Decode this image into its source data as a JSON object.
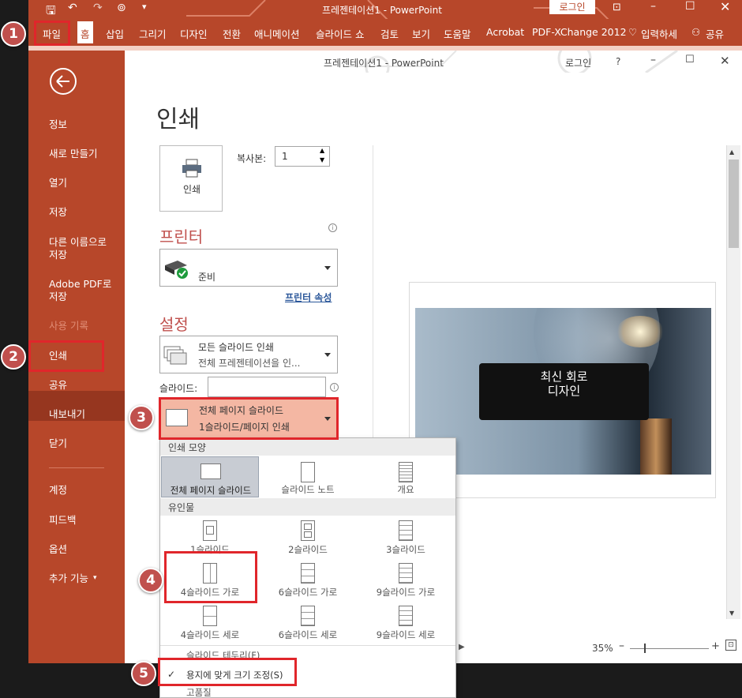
{
  "outer_window": {
    "title": "프레젠테이션1  -  PowerPoint",
    "login": "로그인",
    "tabs": [
      "파일",
      "홈",
      "삽입",
      "그리기",
      "디자인",
      "전환",
      "애니메이션",
      "슬라이드 쇼",
      "검토",
      "보기",
      "도움말",
      "Acrobat",
      "PDF-XChange 2012",
      "입력하세",
      "공유"
    ]
  },
  "inner_window": {
    "title": "프레젠테이션1  -  PowerPoint",
    "login": "로그인",
    "help": "?"
  },
  "sidebar": {
    "items": [
      "정보",
      "새로 만들기",
      "열기",
      "저장",
      "다른 이름으로 저장",
      "Adobe PDF로 저장",
      "사용 기록",
      "인쇄",
      "공유",
      "내보내기",
      "닫기",
      "계정",
      "피드백",
      "옵션",
      "추가 기능"
    ],
    "selected": "인쇄"
  },
  "print": {
    "heading": "인쇄",
    "print_button": "인쇄",
    "copies_label": "복사본:",
    "copies_value": "1",
    "printer_heading": "프린터",
    "printer_status": "준비",
    "printer_properties": "프린터 속성",
    "settings_heading": "설정",
    "range_title": "모든 슬라이드 인쇄",
    "range_sub": "전체 프레젠테이션을 인...",
    "slides_label": "슬라이드:",
    "layout_title": "전체 페이지 슬라이드",
    "layout_sub": "1슬라이드/페이지 인쇄"
  },
  "dropdown": {
    "print_layout_header": "인쇄 모양",
    "print_layout_items": [
      "전체 페이지 슬라이드",
      "슬라이드 노트",
      "개요"
    ],
    "handouts_header": "유인물",
    "handout_items": [
      "1슬라이드",
      "2슬라이드",
      "3슬라이드",
      "4슬라이드 가로",
      "6슬라이드 가로",
      "9슬라이드 가로",
      "4슬라이드 세로",
      "6슬라이드 세로",
      "9슬라이드 세로"
    ],
    "frame_option": "슬라이드 테두리(F)",
    "scale_option": "용지에 맞게 크기 조정(S)",
    "high_quality": "고품질"
  },
  "preview": {
    "slide_title_line1": "최신 회로",
    "slide_title_line2": "디자인",
    "zoom": "35%"
  },
  "steps": [
    "1",
    "2",
    "3",
    "4",
    "5"
  ],
  "colors": {
    "accent": "#b7472a",
    "highlight": "#e0262b",
    "badge": "#c0504d"
  }
}
